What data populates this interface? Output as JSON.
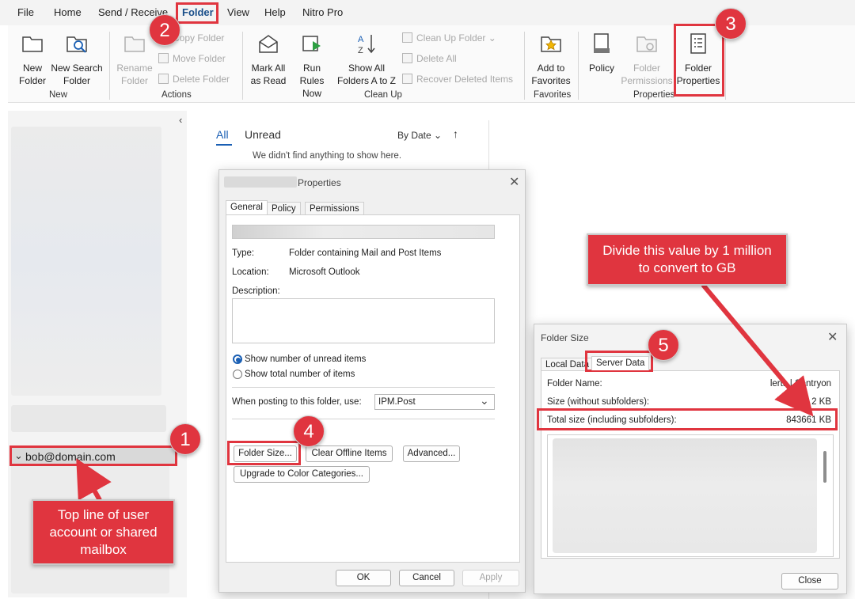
{
  "menubar": {
    "items": [
      "File",
      "Home",
      "Send / Receive",
      "Folder",
      "View",
      "Help",
      "Nitro Pro"
    ]
  },
  "ribbon": {
    "new_folder": [
      "New",
      "Folder"
    ],
    "new_search_folder": [
      "New Search",
      "Folder"
    ],
    "rename_folder": [
      "Rename",
      "Folder"
    ],
    "copy_folder": "Copy Folder",
    "move_folder": "Move Folder",
    "delete_folder": "Delete Folder",
    "mark_all_read": [
      "Mark All",
      "as Read"
    ],
    "run_rules": [
      "Run Rules",
      "Now"
    ],
    "show_all_folders": [
      "Show All",
      "Folders A to Z"
    ],
    "clean_up_folder": "Clean Up Folder",
    "delete_all": "Delete All",
    "recover_deleted": "Recover Deleted Items",
    "add_favorites": [
      "Add to",
      "Favorites"
    ],
    "policy": "Policy",
    "folder_permissions": [
      "Folder",
      "Permissions"
    ],
    "folder_properties": [
      "Folder",
      "Properties"
    ],
    "groups": {
      "new": "New",
      "actions": "Actions",
      "cleanup": "Clean Up",
      "favorites": "Favorites",
      "properties": "Properties"
    }
  },
  "mailbox": {
    "account": "bob@domain.com"
  },
  "message_list": {
    "tab_all": "All",
    "tab_unread": "Unread",
    "sort": "By Date",
    "empty_text": "We didn't find anything to show here."
  },
  "properties_dialog": {
    "title": "Properties",
    "tabs": [
      "General",
      "Policy",
      "Permissions"
    ],
    "type_label": "Type:",
    "type_value": "Folder containing Mail and Post Items",
    "location_label": "Location:",
    "location_value": "Microsoft Outlook",
    "description_label": "Description:",
    "radio_unread": "Show number of unread items",
    "radio_total": "Show total number of items",
    "posting_label": "When posting to this folder, use:",
    "posting_value": "IPM.Post",
    "btn_folder_size": "Folder Size...",
    "btn_clear_offline": "Clear Offline Items",
    "btn_advanced": "Advanced...",
    "btn_upgrade": "Upgrade to Color Categories...",
    "btn_ok": "OK",
    "btn_cancel": "Cancel",
    "btn_apply": "Apply"
  },
  "folder_size_dialog": {
    "title": "Folder Size",
    "tab_local": "Local Data",
    "tab_server": "Server Data",
    "folder_name_label": "Folder Name:",
    "folder_name_value": "lerts | Sentryon",
    "size_label": "Size (without subfolders):",
    "size_value": "2 KB",
    "total_label": "Total size (including subfolders):",
    "total_value": "843661 KB",
    "btn_close": "Close"
  },
  "callouts": {
    "step1": "1",
    "step2": "2",
    "step3": "3",
    "step4": "4",
    "step5": "5",
    "note_top_line": "Top line of user account or shared mailbox",
    "note_divide": "Divide this value by 1 million to convert to GB"
  },
  "colors": {
    "accent_red": "#e0353f",
    "link_blue": "#1a5fb4"
  }
}
